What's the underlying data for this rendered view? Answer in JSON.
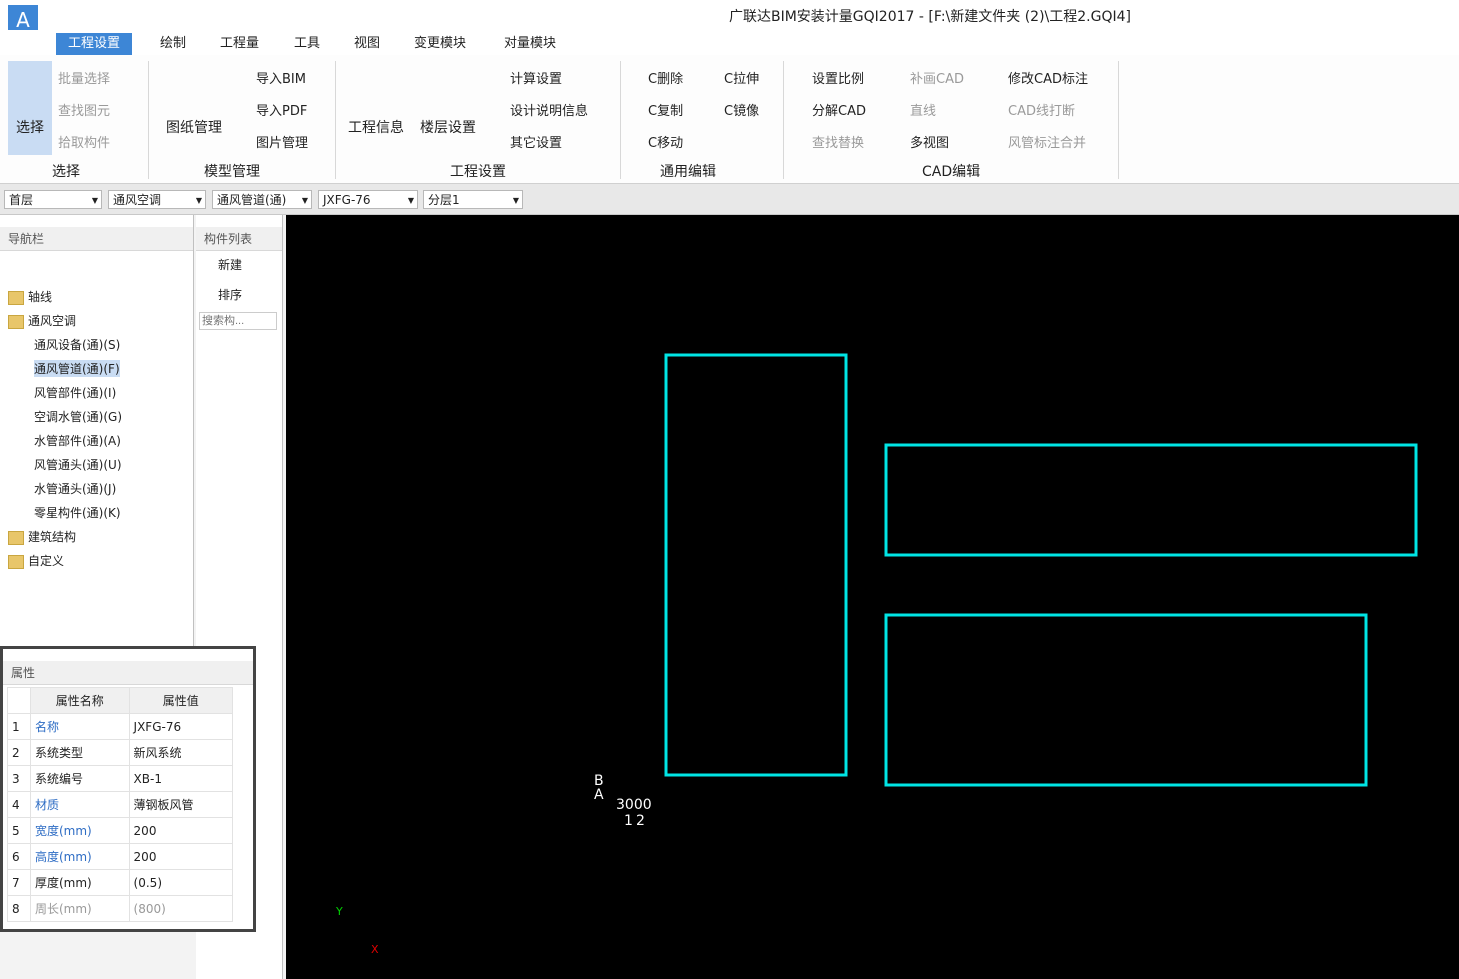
{
  "app": {
    "title": "广联达BIM安装计量GQI2017 - [F:\\新建文件夹 (2)\\工程2.GQI4]",
    "logo_letter": "A",
    "accent": "#3d86d6"
  },
  "tabs": [
    "工程设置",
    "绘制",
    "工程量",
    "工具",
    "视图",
    "变更模块",
    "对量模块"
  ],
  "ribbon": {
    "groups": [
      "选择",
      "模型管理",
      "工程设置",
      "通用编辑",
      "CAD编辑"
    ],
    "select_big": "选择",
    "select_items": [
      "批量选择",
      "查找图元",
      "拾取构件"
    ],
    "drawing_mgmt": "图纸管理",
    "model_items": [
      "导入BIM",
      "导入PDF",
      "图片管理"
    ],
    "project_info": "工程信息",
    "floor_settings": "楼层设置",
    "setup_items": [
      "计算设置",
      "设计说明信息",
      "其它设置"
    ],
    "edit_items": [
      "C删除",
      "C拉伸",
      "C复制",
      "C镜像",
      "C移动"
    ],
    "cad_items": [
      "设置比例",
      "补画CAD",
      "修改CAD标注",
      "分解CAD",
      "直线",
      "CAD线打断",
      "查找替换",
      "多视图",
      "风管标注合并"
    ]
  },
  "dropdowns": [
    "首层",
    "通风空调",
    "通风管道(通)",
    "JXFG-76",
    "分层1"
  ],
  "nav": {
    "title": "导航栏",
    "tree": [
      {
        "label": "轴线",
        "icon": "folder-icon"
      },
      {
        "label": "通风空调",
        "icon": "folder-open-icon"
      },
      {
        "label": "通风设备(通)(S)",
        "icon": "equipment-icon"
      },
      {
        "label": "通风管道(通)(F)",
        "icon": "duct-icon"
      },
      {
        "label": "风管部件(通)(I)",
        "icon": "duct-part-icon"
      },
      {
        "label": "空调水管(通)(G)",
        "icon": "water-pipe-icon"
      },
      {
        "label": "水管部件(通)(A)",
        "icon": "pipe-part-icon"
      },
      {
        "label": "风管通头(通)(U)",
        "icon": "duct-fitting-icon"
      },
      {
        "label": "水管通头(通)(J)",
        "icon": "pipe-fitting-icon"
      },
      {
        "label": "零星构件(通)(K)",
        "icon": "misc-part-icon"
      },
      {
        "label": "建筑结构",
        "icon": "folder-icon"
      },
      {
        "label": "自定义",
        "icon": "folder-icon"
      }
    ]
  },
  "component_list": {
    "title": "构件列表",
    "new_label": "新建",
    "sort_label": "排序",
    "search_placeholder": "搜索构..."
  },
  "properties": {
    "title": "属性",
    "col_name": "属性名称",
    "col_value": "属性值",
    "rows": [
      {
        "n": "1",
        "name": "名称",
        "value": "JXFG-76"
      },
      {
        "n": "2",
        "name": "系统类型",
        "value": "新风系统"
      },
      {
        "n": "3",
        "name": "系统编号",
        "value": "XB-1"
      },
      {
        "n": "4",
        "name": "材质",
        "value": "薄钢板风管"
      },
      {
        "n": "5",
        "name": "宽度(mm)",
        "value": "200"
      },
      {
        "n": "6",
        "name": "高度(mm)",
        "value": "200"
      },
      {
        "n": "7",
        "name": "厚度(mm)",
        "value": "(0.5)"
      },
      {
        "n": "8",
        "name": "周长(mm)",
        "value": "(800)"
      }
    ]
  },
  "canvas": {
    "annotations": [
      "B",
      "A",
      "3000",
      "3000",
      "1",
      "2"
    ],
    "axis_x": "X",
    "axis_y": "Y"
  }
}
